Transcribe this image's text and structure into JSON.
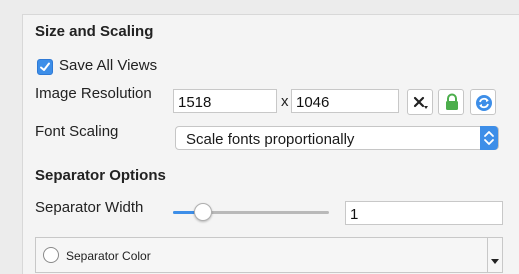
{
  "size_section": {
    "title": "Size and Scaling",
    "save_all_views": {
      "label": "Save All Views",
      "checked": true
    },
    "image_resolution": {
      "label": "Image Resolution",
      "width": "1518",
      "separator": "x",
      "height": "1046"
    },
    "tools": {
      "clear_icon": "x-dropdown-icon",
      "lock_icon": "lock-icon",
      "refresh_icon": "refresh-icon"
    },
    "font_scaling": {
      "label": "Font Scaling",
      "selected": "Scale fonts proportionally"
    }
  },
  "separator_section": {
    "title": "Separator Options",
    "width": {
      "label": "Separator Width",
      "value": "1",
      "slider_fraction": 0.15
    },
    "color": {
      "label": "Separator Color",
      "swatch": "#ffffff"
    }
  },
  "colors": {
    "accent": "#3d8ee8"
  }
}
